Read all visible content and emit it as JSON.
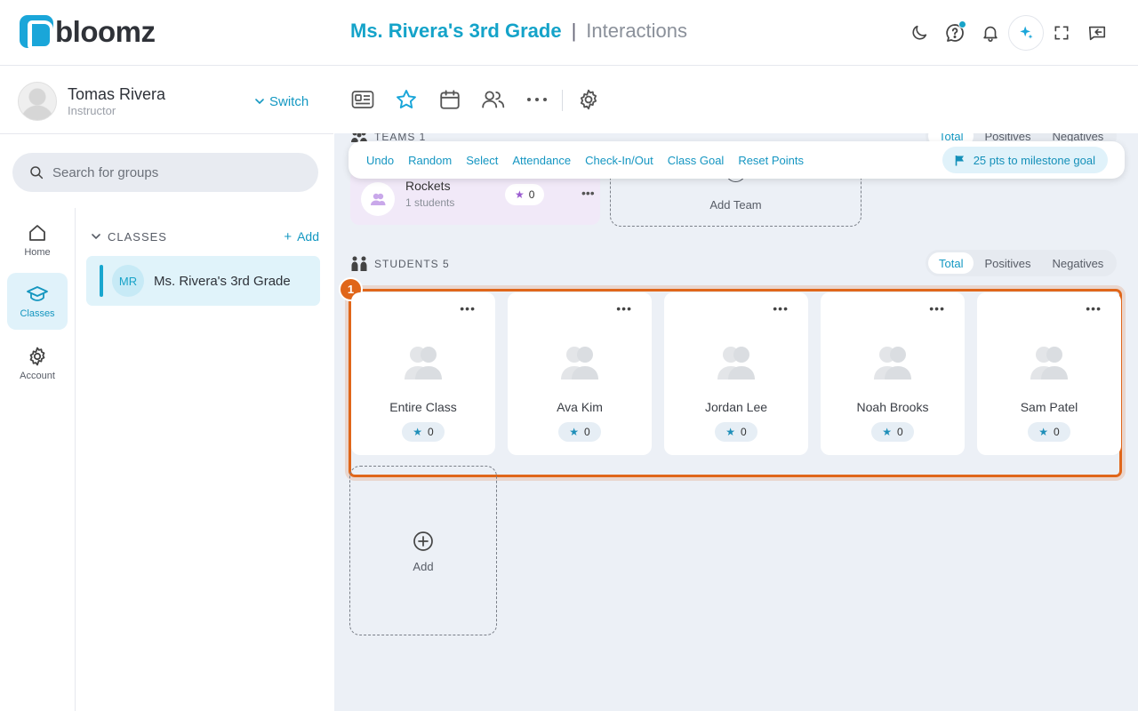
{
  "app": {
    "brand": "bloomz"
  },
  "header": {
    "class_name": "Ms. Rivera's 3rd Grade",
    "separator": "|",
    "page": "Interactions"
  },
  "profile": {
    "name": "Tomas Rivera",
    "role": "Instructor",
    "switch_label": "Switch"
  },
  "search": {
    "placeholder": "Search for groups"
  },
  "nav": [
    {
      "label": "Home",
      "icon": "home-icon"
    },
    {
      "label": "Classes",
      "icon": "graduation-cap-icon",
      "active": true
    },
    {
      "label": "Account",
      "icon": "gear-icon"
    }
  ],
  "classes": {
    "title": "CLASSES",
    "add_label": "Add",
    "items": [
      {
        "initials": "MR",
        "name": "Ms. Rivera's 3rd Grade"
      }
    ]
  },
  "actions": [
    "Undo",
    "Random",
    "Select",
    "Attendance",
    "Check-In/Out",
    "Class Goal",
    "Reset Points"
  ],
  "milestone": "25 pts to milestone goal",
  "teams": {
    "label": "TEAMS 1",
    "filters": [
      "Total",
      "Positives",
      "Negatives"
    ],
    "items": [
      {
        "name": "Rockets",
        "sub": "1 students",
        "points": "0"
      }
    ],
    "add_label": "Add Team"
  },
  "students": {
    "label": "STUDENTS 5",
    "filters": [
      "Total",
      "Positives",
      "Negatives"
    ],
    "selected_filter": "Total",
    "highlight_number": "1",
    "items": [
      {
        "name": "Entire Class",
        "points": "0"
      },
      {
        "name": "Ava Kim",
        "points": "0"
      },
      {
        "name": "Jordan Lee",
        "points": "0"
      },
      {
        "name": "Noah Brooks",
        "points": "0"
      },
      {
        "name": "Sam Patel",
        "points": "0"
      }
    ],
    "add_label": "Add"
  },
  "colors": {
    "accent": "#14a3c9",
    "highlight": "#e0661a",
    "team": "#9a5bd0"
  }
}
